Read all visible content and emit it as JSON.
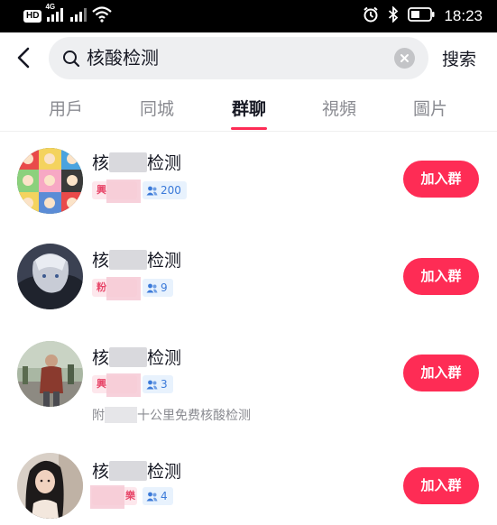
{
  "status_bar": {
    "left_badge": "HD",
    "network_label": "4G",
    "time": "18:23",
    "icons": [
      "hd-icon",
      "signal-icon",
      "signal-icon",
      "wifi-icon",
      "alarm-icon",
      "bluetooth-icon",
      "battery-icon"
    ]
  },
  "search": {
    "query": "核酸检测",
    "submit_label": "搜索"
  },
  "tabs": [
    {
      "label": "用戶"
    },
    {
      "label": "同城"
    },
    {
      "label": "群聊",
      "active": true
    },
    {
      "label": "視頻"
    },
    {
      "label": "圖片"
    }
  ],
  "accent_color": "#fe2c55",
  "results": [
    {
      "title_start": "核",
      "title_end": "检测",
      "tag": "興",
      "member_count": "200",
      "description": "",
      "join_label": "加入群"
    },
    {
      "title_start": "核",
      "title_end": "检测",
      "tag": "粉",
      "member_count": "9",
      "description": "",
      "join_label": "加入群"
    },
    {
      "title_start": "核",
      "title_end": "检测",
      "tag": "興",
      "member_count": "3",
      "description_start": "附",
      "description_end": "十公里免费核酸检测",
      "join_label": "加入群"
    },
    {
      "title_start": "核",
      "title_end": "检测",
      "tag": "樂",
      "member_count": "4",
      "description": "",
      "join_label": "加入群"
    }
  ]
}
